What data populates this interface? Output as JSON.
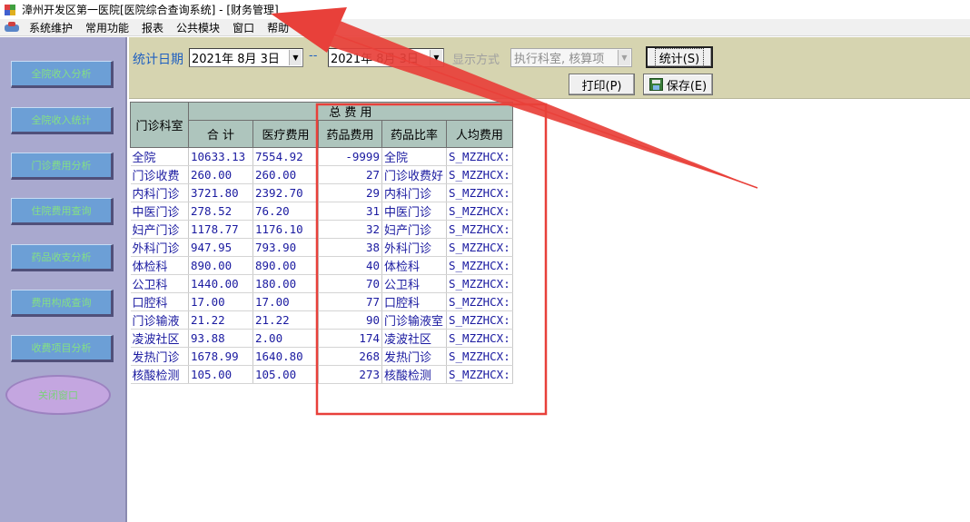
{
  "window": {
    "title": "漳州开发区第一医院[医院综合查询系统] - [财务管理]"
  },
  "menu": {
    "items": [
      "系统维护",
      "常用功能",
      "报表",
      "公共模块",
      "窗口",
      "帮助"
    ]
  },
  "sidebar": {
    "items": [
      "全院收入分析",
      "全院收入统计",
      "门诊费用分析",
      "住院费用查询",
      "药品收支分析",
      "费用构成查询",
      "收费项目分析"
    ],
    "close_label": "关闭窗口"
  },
  "toolbar": {
    "date_label": "统计日期",
    "date_from": "2021年 8月 3日",
    "date_sep": "--",
    "date_to": "2021年 8月 3日",
    "mode_label": "显示方式",
    "mode_value": "执行科室, 核算项",
    "stat_button": "统计(S)",
    "print_button": "打印(P)",
    "save_button": "保存(E)"
  },
  "table": {
    "group_header": "总 费 用",
    "dept_header": "门诊科室",
    "columns": [
      "合  计",
      "医疗费用",
      "药品费用",
      "药品比率",
      "人均费用"
    ],
    "rows": [
      [
        "全院",
        "10633.13",
        "7554.92",
        "-9999",
        "全院",
        "S_MZZHCX:"
      ],
      [
        "门诊收费",
        "260.00",
        "260.00",
        "27",
        "门诊收费好",
        "S_MZZHCX:"
      ],
      [
        "内科门诊",
        "3721.80",
        "2392.70",
        "29",
        "内科门诊",
        "S_MZZHCX:"
      ],
      [
        "中医门诊",
        "278.52",
        "76.20",
        "31",
        "中医门诊",
        "S_MZZHCX:"
      ],
      [
        "妇产门诊",
        "1178.77",
        "1176.10",
        "32",
        "妇产门诊",
        "S_MZZHCX:"
      ],
      [
        "外科门诊",
        "947.95",
        "793.90",
        "38",
        "外科门诊",
        "S_MZZHCX:"
      ],
      [
        "体检科",
        "890.00",
        "890.00",
        "40",
        "体检科",
        "S_MZZHCX:"
      ],
      [
        "公卫科",
        "1440.00",
        "180.00",
        "70",
        "公卫科",
        "S_MZZHCX:"
      ],
      [
        "口腔科",
        "17.00",
        "17.00",
        "77",
        "口腔科",
        "S_MZZHCX:"
      ],
      [
        "门诊输液",
        "21.22",
        "21.22",
        "90",
        "门诊输液室",
        "S_MZZHCX:"
      ],
      [
        "凌波社区",
        "93.88",
        "2.00",
        "174",
        "凌波社区",
        "S_MZZHCX:"
      ],
      [
        "发热门诊",
        "1678.99",
        "1640.80",
        "268",
        "发热门诊",
        "S_MZZHCX:"
      ],
      [
        "核酸检测",
        "105.00",
        "105.00",
        "273",
        "核酸检测",
        "S_MZZHCX:"
      ]
    ]
  },
  "colors": {
    "annotation": "#e8403a",
    "sidebar_bg": "#a9a9cf",
    "toolbar_bg": "#d6d4b0",
    "header_bg": "#aec5bd",
    "cell_text": "#1a1aa0"
  }
}
